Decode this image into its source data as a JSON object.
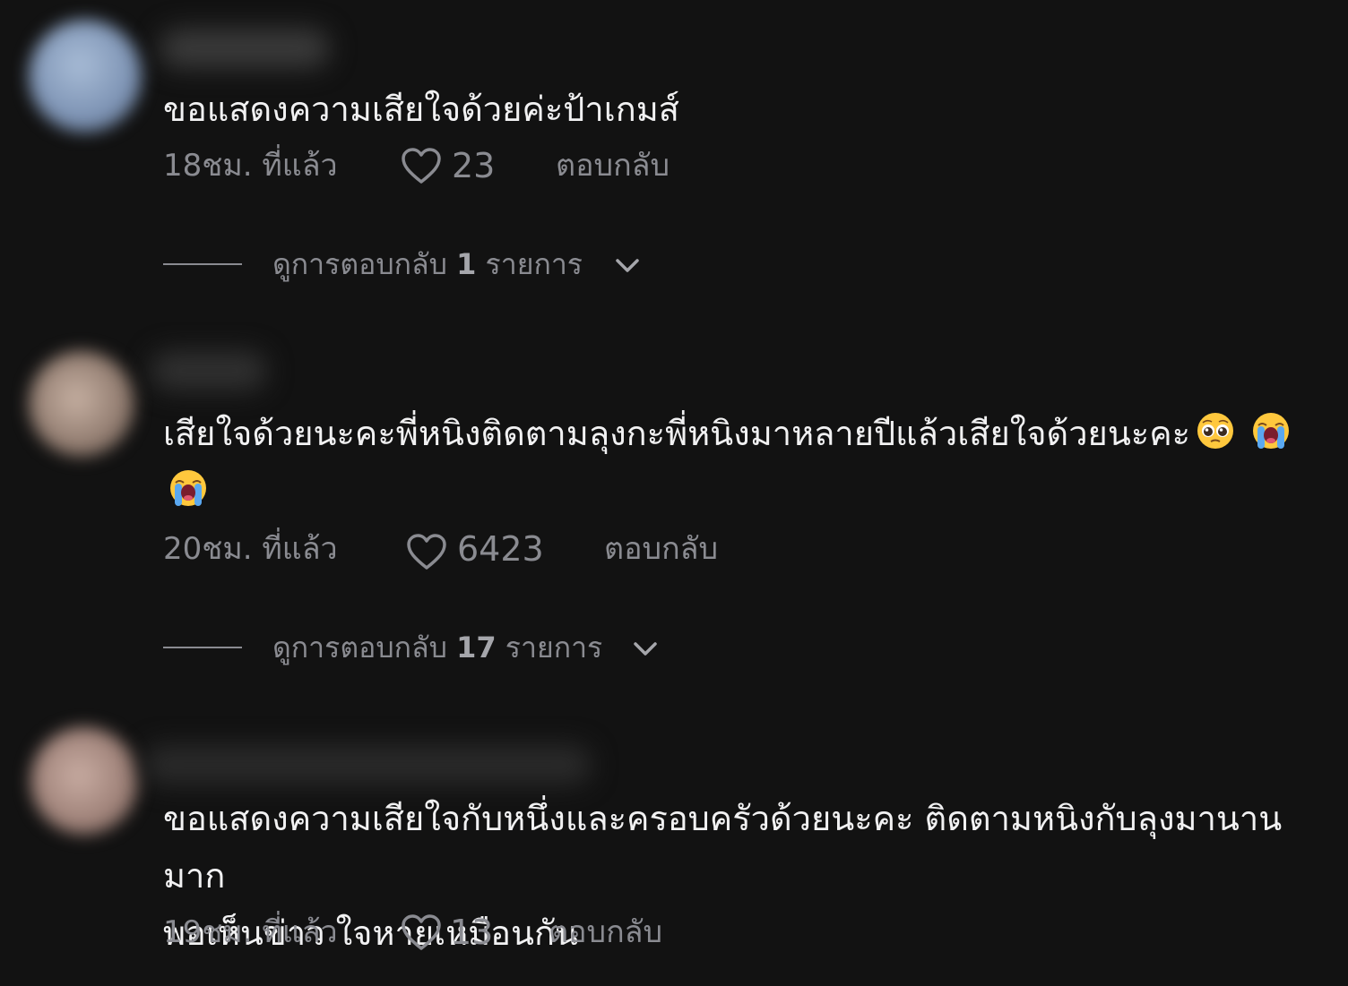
{
  "comments": [
    {
      "text": "ขอแสดงความเสียใจด้วยค่ะป้าเกมส์",
      "time": "18ชม. ที่แล้ว",
      "likes": "23",
      "reply_label": "ตอบกลับ",
      "view_replies_prefix": "ดูการตอบกลับ",
      "view_replies_count": "1",
      "view_replies_suffix": "รายการ",
      "avatar_color": "#8aa4c6",
      "emojis": []
    },
    {
      "text": "เสียใจด้วยนะคะพี่หนิงติดตามลุงกะพี่หนิงมาหลายปีแล้วเสียใจด้วยนะคะ",
      "time": "20ชม. ที่แล้ว",
      "likes": "6423",
      "reply_label": "ตอบกลับ",
      "view_replies_prefix": "ดูการตอบกลับ",
      "view_replies_count": "17",
      "view_replies_suffix": "รายการ",
      "avatar_color": "#9a8a80",
      "emojis": [
        "pleading-face-emoji",
        "loudly-crying-face-emoji",
        "loudly-crying-face-emoji"
      ]
    },
    {
      "text_line1": "ขอแสดงความเสียใจกับหนึ่งและครอบครัวด้วยนะคะ ติดตามหนิงกับลุงมานานมาก",
      "text_line2": "พอเห็นข่าว ใจหายเหมือนกัน",
      "time": "19ชม. ที่แล้ว",
      "likes": "13",
      "reply_label": "ตอบกลับ",
      "avatar_color": "#a89088",
      "emojis": []
    }
  ],
  "colors": {
    "background": "#121212",
    "text_primary": "#f1f1f2",
    "text_secondary": "#8a8b91"
  }
}
